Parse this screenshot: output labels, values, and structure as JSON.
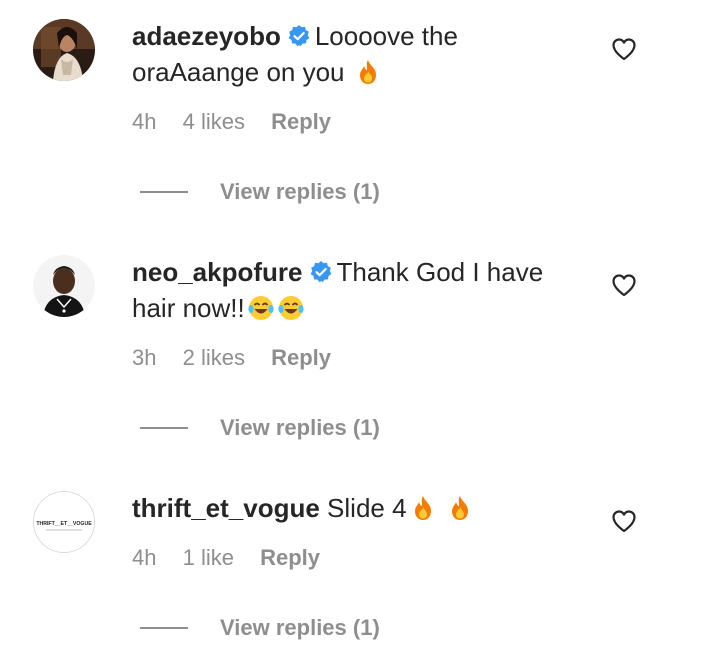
{
  "comments": [
    {
      "username": "adaezeyobo",
      "verified": true,
      "text_line1": "Loooove the",
      "text_line2": "oraAaange on you",
      "emojis": [
        "fire"
      ],
      "time": "4h",
      "likes": "4 likes",
      "reply_label": "Reply",
      "view_replies": "View replies (1)",
      "avatar_icon": "profile-photo-woman"
    },
    {
      "username": "neo_akpofure",
      "verified": true,
      "text_line1": "Thank God I have",
      "text_line2": "hair now!!",
      "emojis": [
        "face-with-tears-of-joy",
        "face-with-tears-of-joy"
      ],
      "time": "3h",
      "likes": "2 likes",
      "reply_label": "Reply",
      "view_replies": "View replies (1)",
      "avatar_icon": "profile-photo-man"
    },
    {
      "username": "thrift_et_vogue",
      "verified": false,
      "text_line1": "Slide 4",
      "emojis": [
        "fire",
        "fire"
      ],
      "time": "4h",
      "likes": "1 like",
      "reply_label": "Reply",
      "view_replies": "View replies (1)",
      "avatar_icon": "brand-logo",
      "avatar_text": "THRIFT__ET__VOGUE"
    }
  ],
  "colors": {
    "text": "#262626",
    "secondary": "#8e8e8e",
    "verified_blue": "#3897f0"
  }
}
